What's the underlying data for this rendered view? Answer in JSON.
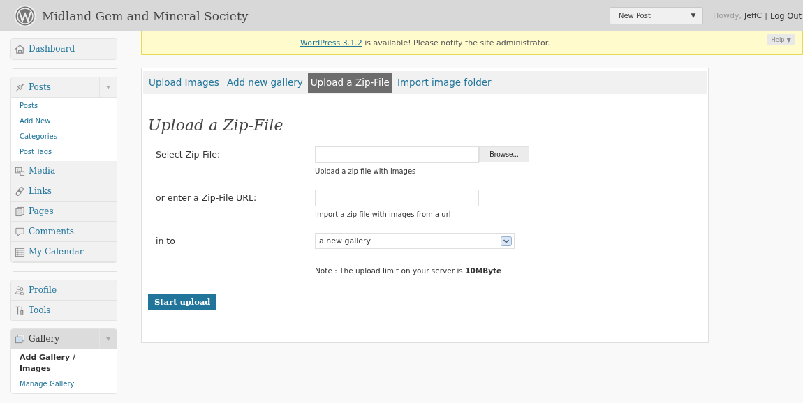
{
  "header": {
    "site_title": "Midland Gem and Mineral Society",
    "favorites": {
      "label": "New Post",
      "toggle": "▼"
    },
    "greeting": "Howdy,",
    "user": "JeffC",
    "separator": "|",
    "logout": "Log Out"
  },
  "notice": {
    "link": "WordPress 3.1.2",
    "text": "is available! Please notify the site administrator."
  },
  "help": {
    "label": "Help",
    "toggle": "▼"
  },
  "sidebar": {
    "groups": [
      {
        "separator_after": true,
        "items": [
          {
            "label": "Dashboard",
            "expanded": false,
            "current": false
          }
        ]
      },
      {
        "separator_after": true,
        "items": [
          {
            "label": "Posts",
            "expanded": true,
            "current": false,
            "children": [
              {
                "label": "Posts",
                "selected": false
              },
              {
                "label": "Add New",
                "selected": false
              },
              {
                "label": "Categories",
                "selected": false
              },
              {
                "label": "Post Tags",
                "selected": false
              }
            ]
          },
          {
            "label": "Media",
            "expanded": false,
            "current": false
          },
          {
            "label": "Links",
            "expanded": false,
            "current": false
          },
          {
            "label": "Pages",
            "expanded": false,
            "current": false
          },
          {
            "label": "Comments",
            "expanded": false,
            "current": false
          },
          {
            "label": "My Calendar",
            "expanded": false,
            "current": false
          }
        ]
      },
      {
        "separator_after": false,
        "items": [
          {
            "label": "Profile",
            "expanded": false,
            "current": false
          },
          {
            "label": "Tools",
            "expanded": false,
            "current": false
          }
        ]
      },
      {
        "separator_after": false,
        "items": [
          {
            "label": "Gallery",
            "expanded": true,
            "current": true,
            "children": [
              {
                "label": "Add Gallery / Images",
                "selected": true
              },
              {
                "label": "Manage Gallery",
                "selected": false
              }
            ]
          }
        ]
      }
    ]
  },
  "tabs": [
    {
      "label": "Upload Images",
      "selected": false
    },
    {
      "label": "Add new gallery",
      "selected": false
    },
    {
      "label": "Upload a Zip-File",
      "selected": true
    },
    {
      "label": "Import image folder",
      "selected": false
    }
  ],
  "heading": "Upload a Zip-File",
  "form": [
    {
      "kind": "file",
      "label": "Select Zip-File:",
      "button": "Browse...",
      "hint": "Upload a zip file with images"
    },
    {
      "kind": "text",
      "label": "or enter a Zip-File URL:",
      "hint": "Import a zip file with images from a url"
    },
    {
      "kind": "select",
      "label": "in to",
      "value": "a new gallery"
    },
    {
      "kind": "note",
      "text": "Note : The upload limit on your server is **10MByte**"
    }
  ],
  "submit": "Start upload"
}
